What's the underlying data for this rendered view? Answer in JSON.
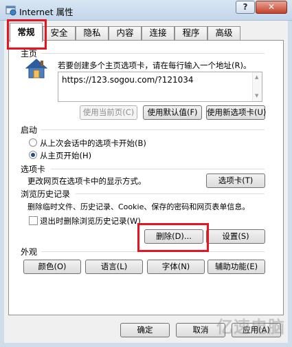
{
  "window": {
    "title": "Internet 属性",
    "help_label": "?",
    "close_label": "✕"
  },
  "tabs": [
    {
      "label": "常规",
      "active": true
    },
    {
      "label": "安全"
    },
    {
      "label": "隐私"
    },
    {
      "label": "内容"
    },
    {
      "label": "连接"
    },
    {
      "label": "程序"
    },
    {
      "label": "高级"
    }
  ],
  "homepage": {
    "group_title": "主页",
    "description": "若要创建多个主页选项卡，请在每行输入一个地址(R)。",
    "url": "https://123.sogou.com/?121034",
    "use_current_label": "使用当前页(C)",
    "use_default_label": "使用默认值(F)",
    "use_new_tab_label": "使用新选项卡(U)"
  },
  "startup": {
    "group_title": "启动",
    "option_last_session": "从上次会话中的选项卡开始(B)",
    "option_home_page": "从主页开始(H)",
    "selected": "option_home_page"
  },
  "tabs_section": {
    "group_title": "选项卡",
    "description": "更改网页在选项卡中的显示方式。",
    "button_label": "选项卡(T)"
  },
  "history": {
    "group_title": "浏览历史记录",
    "description": "删除临时文件、历史记录、Cookie、保存的密码和网页表单信息。",
    "checkbox_label": "退出时删除浏览历史记录(W)",
    "checkbox_checked": false,
    "delete_label": "删除(D)...",
    "settings_label": "设置(S)"
  },
  "appearance": {
    "group_title": "外观",
    "colors_label": "颜色(O)",
    "languages_label": "语言(L)",
    "fonts_label": "字体(N)",
    "accessibility_label": "辅助功能(E)"
  },
  "footer": {
    "ok_label": "确定",
    "cancel_label": "取消",
    "apply_label": "应用(A)"
  },
  "watermark": "亿速电脑",
  "colors": {
    "highlight": "#e8131f",
    "selected_radio": "#1d4f8a"
  }
}
